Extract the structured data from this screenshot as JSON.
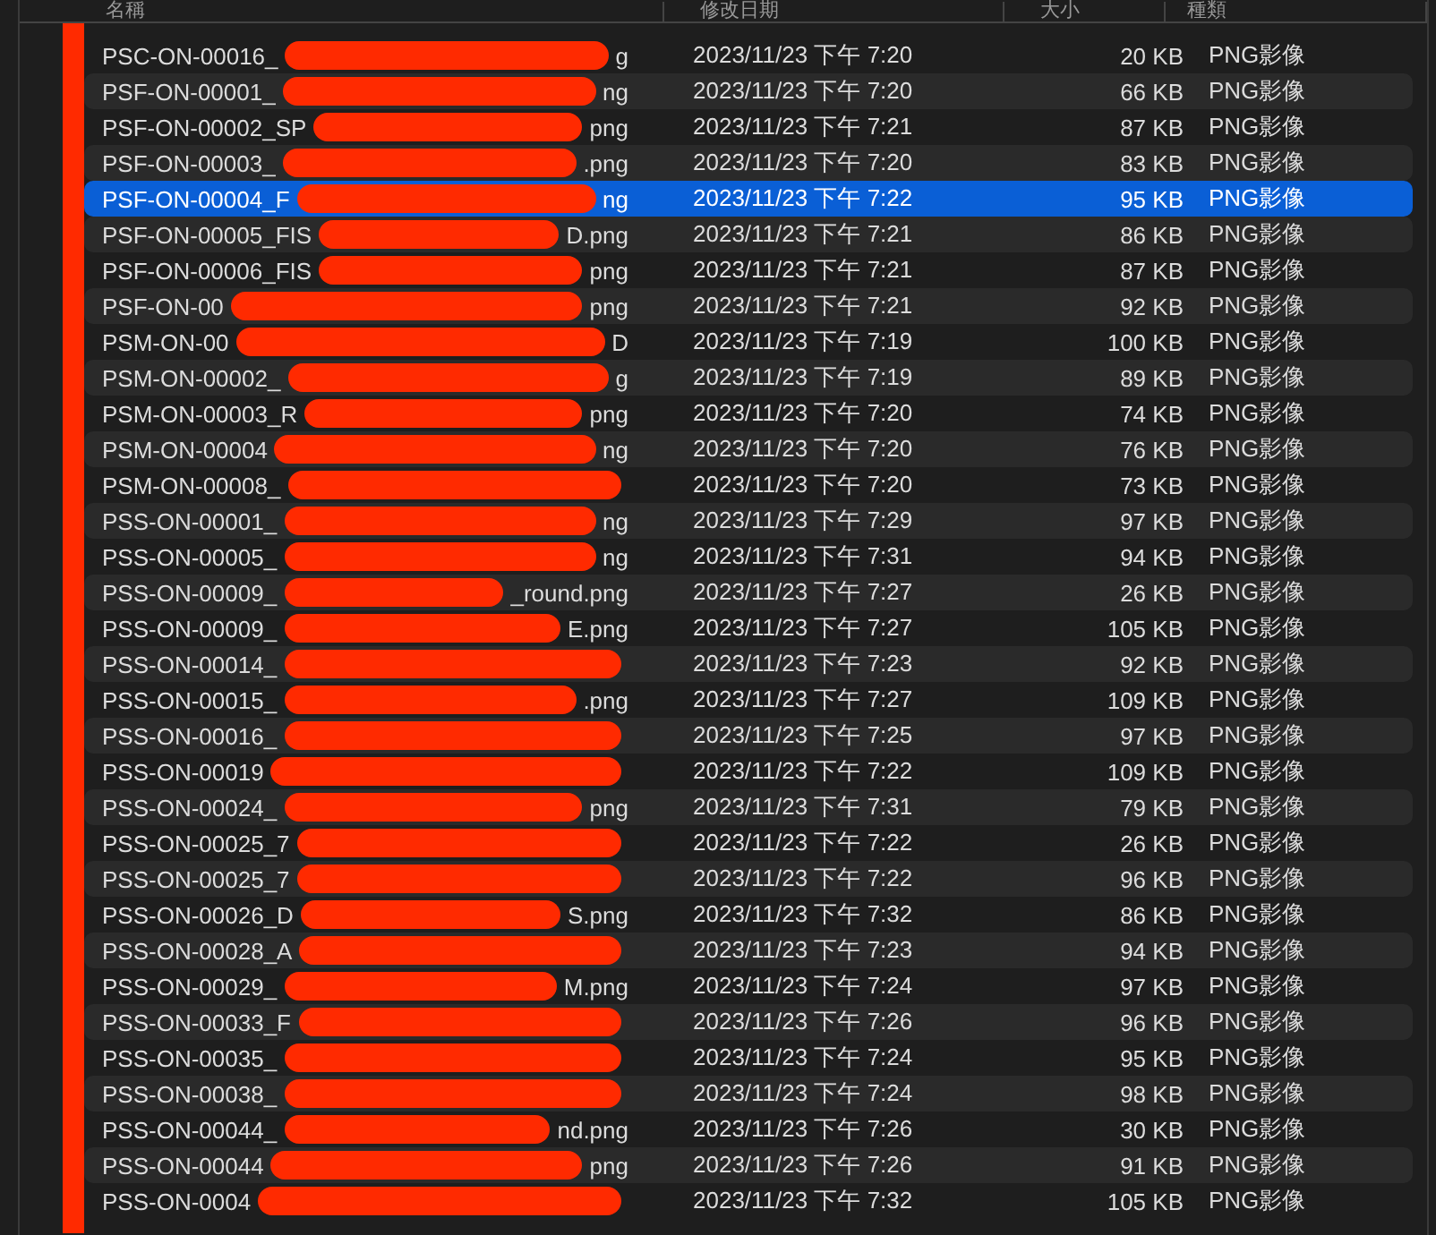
{
  "columns": [
    "名稱",
    "修改日期",
    "大小",
    "種類"
  ],
  "rows": [
    {
      "name": "PSC-ON-00016_",
      "name_end": "g",
      "date": "2023/11/23 下午 7:20",
      "size": "20 KB",
      "kind": "PNG影像",
      "selected": false
    },
    {
      "name": "PSF-ON-00001_",
      "name_end": "ng",
      "date": "2023/11/23 下午 7:20",
      "size": "66 KB",
      "kind": "PNG影像",
      "selected": false
    },
    {
      "name": "PSF-ON-00002_SP",
      "name_end": "png",
      "date": "2023/11/23 下午 7:21",
      "size": "87 KB",
      "kind": "PNG影像",
      "selected": false
    },
    {
      "name": "PSF-ON-00003_",
      "name_end": ".png",
      "date": "2023/11/23 下午 7:20",
      "size": "83 KB",
      "kind": "PNG影像",
      "selected": false
    },
    {
      "name": "PSF-ON-00004_F",
      "name_end": "ng",
      "date": "2023/11/23 下午 7:22",
      "size": "95 KB",
      "kind": "PNG影像",
      "selected": true
    },
    {
      "name": "PSF-ON-00005_FIS",
      "name_end": "D.png",
      "date": "2023/11/23 下午 7:21",
      "size": "86 KB",
      "kind": "PNG影像",
      "selected": false
    },
    {
      "name": "PSF-ON-00006_FIS",
      "name_end": "png",
      "date": "2023/11/23 下午 7:21",
      "size": "87 KB",
      "kind": "PNG影像",
      "selected": false
    },
    {
      "name": "PSF-ON-00",
      "name_end": "png",
      "date": "2023/11/23 下午 7:21",
      "size": "92 KB",
      "kind": "PNG影像",
      "selected": false
    },
    {
      "name": "PSM-ON-00",
      "name_end": "D",
      "date": "2023/11/23 下午 7:19",
      "size": "100 KB",
      "kind": "PNG影像",
      "selected": false
    },
    {
      "name": "PSM-ON-00002_",
      "name_end": "g",
      "date": "2023/11/23 下午 7:19",
      "size": "89 KB",
      "kind": "PNG影像",
      "selected": false
    },
    {
      "name": "PSM-ON-00003_R",
      "name_end": "png",
      "date": "2023/11/23 下午 7:20",
      "size": "74 KB",
      "kind": "PNG影像",
      "selected": false
    },
    {
      "name": "PSM-ON-00004",
      "name_end": "ng",
      "date": "2023/11/23 下午 7:20",
      "size": "76 KB",
      "kind": "PNG影像",
      "selected": false
    },
    {
      "name": "PSM-ON-00008_",
      "date": "2023/11/23 下午 7:20",
      "size": "73 KB",
      "kind": "PNG影像",
      "selected": false
    },
    {
      "name": "PSS-ON-00001_",
      "name_end": "ng",
      "date": "2023/11/23 下午 7:29",
      "size": "97 KB",
      "kind": "PNG影像",
      "selected": false
    },
    {
      "name": "PSS-ON-00005_",
      "name_end": "ng",
      "date": "2023/11/23 下午 7:31",
      "size": "94 KB",
      "kind": "PNG影像",
      "selected": false
    },
    {
      "name": "PSS-ON-00009_",
      "name_end": "_round.png",
      "date": "2023/11/23 下午 7:27",
      "size": "26 KB",
      "kind": "PNG影像",
      "selected": false
    },
    {
      "name": "PSS-ON-00009_",
      "name_end": "E.png",
      "date": "2023/11/23 下午 7:27",
      "size": "105 KB",
      "kind": "PNG影像",
      "selected": false
    },
    {
      "name": "PSS-ON-00014_",
      "date": "2023/11/23 下午 7:23",
      "size": "92 KB",
      "kind": "PNG影像",
      "selected": false
    },
    {
      "name": "PSS-ON-00015_",
      "name_end": ".png",
      "date": "2023/11/23 下午 7:27",
      "size": "109 KB",
      "kind": "PNG影像",
      "selected": false
    },
    {
      "name": "PSS-ON-00016_",
      "date": "2023/11/23 下午 7:25",
      "size": "97 KB",
      "kind": "PNG影像",
      "selected": false
    },
    {
      "name": "PSS-ON-00019",
      "date": "2023/11/23 下午 7:22",
      "size": "109 KB",
      "kind": "PNG影像",
      "selected": false
    },
    {
      "name": "PSS-ON-00024_",
      "name_end": "png",
      "date": "2023/11/23 下午 7:31",
      "size": "79 KB",
      "kind": "PNG影像",
      "selected": false
    },
    {
      "name": "PSS-ON-00025_7",
      "date": "2023/11/23 下午 7:22",
      "size": "26 KB",
      "kind": "PNG影像",
      "selected": false
    },
    {
      "name": "PSS-ON-00025_7",
      "date": "2023/11/23 下午 7:22",
      "size": "96 KB",
      "kind": "PNG影像",
      "selected": false
    },
    {
      "name": "PSS-ON-00026_D",
      "name_end": "S.png",
      "date": "2023/11/23 下午 7:32",
      "size": "86 KB",
      "kind": "PNG影像",
      "selected": false
    },
    {
      "name": "PSS-ON-00028_A",
      "date": "2023/11/23 下午 7:23",
      "size": "94 KB",
      "kind": "PNG影像",
      "selected": false
    },
    {
      "name": "PSS-ON-00029_",
      "name_end": "M.png",
      "date": "2023/11/23 下午 7:24",
      "size": "97 KB",
      "kind": "PNG影像",
      "selected": false
    },
    {
      "name": "PSS-ON-00033_F",
      "date": "2023/11/23 下午 7:26",
      "size": "96 KB",
      "kind": "PNG影像",
      "selected": false
    },
    {
      "name": "PSS-ON-00035_",
      "date": "2023/11/23 下午 7:24",
      "size": "95 KB",
      "kind": "PNG影像",
      "selected": false
    },
    {
      "name": "PSS-ON-00038_",
      "date": "2023/11/23 下午 7:24",
      "size": "98 KB",
      "kind": "PNG影像",
      "selected": false
    },
    {
      "name": "PSS-ON-00044_",
      "name_end": "nd.png",
      "date": "2023/11/23 下午 7:26",
      "size": "30 KB",
      "kind": "PNG影像",
      "selected": false
    },
    {
      "name": "PSS-ON-00044",
      "name_end": "png",
      "date": "2023/11/23 下午 7:26",
      "size": "91 KB",
      "kind": "PNG影像",
      "selected": false
    },
    {
      "name": "PSS-ON-0004",
      "date": "2023/11/23 下午 7:32",
      "size": "105 KB",
      "kind": "PNG影像",
      "selected": false
    }
  ]
}
